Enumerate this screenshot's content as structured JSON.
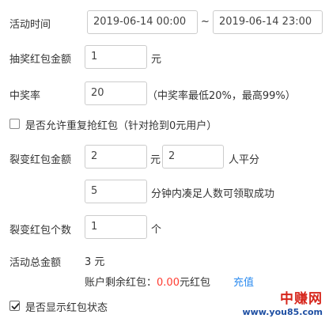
{
  "activity_time": {
    "label": "活动时间",
    "start_value": "2019-06-14 00:00",
    "separator": "~",
    "end_value": "2019-06-14 23:00"
  },
  "lottery_amount": {
    "label": "抽奖红包金额",
    "value": "1",
    "unit": "元"
  },
  "win_rate": {
    "label": "中奖率",
    "value": "20",
    "hint": "（中奖率最低20%，最高99%）"
  },
  "repeat_grab": {
    "checked": false,
    "label": "是否允许重复抢红包（针对抢到0元用户）"
  },
  "fission_amount": {
    "label": "裂变红包金额",
    "amount_value": "2",
    "amount_unit": "元",
    "people_value": "2",
    "people_suffix": "人平分",
    "minutes_value": "5",
    "minutes_suffix": "分钟内凑足人数可领取成功"
  },
  "fission_count": {
    "label": "裂变红包个数",
    "value": "1",
    "unit": "个"
  },
  "total_amount": {
    "label": "活动总金额",
    "value": "3 元",
    "balance_prefix": "账户剩余红包：",
    "balance_value": "0.00",
    "balance_suffix": "元红包",
    "recharge_link": "充值"
  },
  "show_status": {
    "checked": true,
    "label": "是否显示红包状态"
  },
  "watermark": {
    "brand": "中赚网",
    "site": "www.you85.com"
  },
  "colors": {
    "accent_link": "#2d8cf0",
    "balance_red": "#ff3b30",
    "border": "#cccccc"
  }
}
